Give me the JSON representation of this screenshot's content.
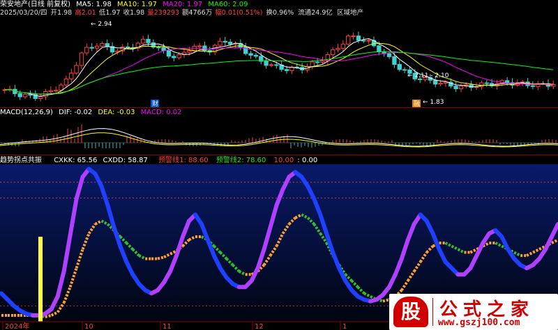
{
  "header": {
    "stock_title": "荣安地产(日线 前复权)",
    "ma5": "MA5: 1.98",
    "ma10": "MA10: 1.97",
    "ma20": "MA20: 1.97",
    "ma60": "MA60: 2.09",
    "date": "2025/03/20/四",
    "open": "开1.98",
    "high": "高2.01",
    "low": "低1.97",
    "close": "收1.98",
    "volume": "量239293",
    "amount": "额4766万",
    "change": "幅0.01(0.51%)",
    "turnover": "换0.96%",
    "float_cap": "流通24.9亿",
    "sector": "区域地产"
  },
  "macd_header": {
    "title": "MACD(12,26,9)",
    "dif": "DIF: -0.02",
    "dea": "DEA: -0.03",
    "macd": "MACD: 0.02"
  },
  "ind_header": {
    "title": "趋势拐点共振",
    "cxkk": "CXKK: 65.56",
    "cxdd": "CXDD: 58.87",
    "warn1": "预警线1: 88.60",
    "warn2": "预警线2: 78.60",
    "ten": "10.00",
    "zero": ": 0.00"
  },
  "annotations": {
    "high_price": "2.94",
    "low_price": "1.83",
    "range_label": "2.11 - 2.10",
    "badge_cai": "财",
    "badge_mao": "融"
  },
  "x_axis": {
    "labels": [
      "2024年",
      "10",
      "11",
      "12",
      "1"
    ]
  },
  "colors": {
    "up": "#ff4040",
    "down": "#40d0d0",
    "ma5": "#ffffff",
    "ma10": "#ffff00",
    "ma20": "#ff00ff",
    "ma60": "#00ff00",
    "cxkk_up": "#b040ff",
    "cxkk_down": "#2040ff",
    "cxdd_up": "#ffa030",
    "cxdd_down": "#30c030",
    "warn": "#ff4040",
    "marker": "#ffff40"
  },
  "logo": {
    "mark": "股",
    "name": "公式之家",
    "url": "www.gszj100.com"
  },
  "chart_data": [
    {
      "type": "candlestick",
      "title": "荣安地产(日线 前复权)",
      "ylim": [
        1.8,
        3.0
      ],
      "annotations": [
        {
          "label": "2.94"
        },
        {
          "label": "1.83"
        },
        {
          "label": "2.11 - 2.10"
        }
      ],
      "values": []
    },
    {
      "type": "bar",
      "title": "MACD(12,26,9)",
      "series": [
        {
          "name": "DIF",
          "last": -0.02
        },
        {
          "name": "DEA",
          "last": -0.03
        },
        {
          "name": "MACD",
          "last": 0.02
        }
      ]
    },
    {
      "type": "line",
      "title": "趋势拐点共振",
      "ylim": [
        0,
        100
      ],
      "reference_lines": [
        88.6,
        78.6,
        10.0,
        0.0
      ],
      "series": [
        {
          "name": "CXKK",
          "values": [
            18,
            14,
            10,
            7,
            5,
            4,
            4,
            5,
            8,
            16,
            32,
            55,
            78,
            92,
            97,
            94,
            86,
            74,
            60,
            48,
            38,
            30,
            24,
            20,
            18,
            20,
            25,
            32,
            42,
            54,
            64,
            68,
            62,
            52,
            42,
            34,
            28,
            24,
            22,
            22,
            26,
            34,
            46,
            60,
            74,
            84,
            92,
            95,
            92,
            86,
            78,
            68,
            56,
            44,
            34,
            26,
            20,
            16,
            14,
            13,
            14,
            17,
            22,
            30,
            40,
            52,
            62,
            68,
            64,
            56,
            46,
            38,
            34,
            30,
            30,
            34,
            42,
            50,
            56,
            58,
            54,
            46,
            40,
            36,
            34,
            36,
            40,
            46,
            54,
            62
          ]
        },
        {
          "name": "CXDD",
          "values": [
            4,
            4,
            4,
            4,
            4,
            4,
            4,
            3,
            4,
            6,
            12,
            22,
            34,
            46,
            56,
            62,
            64,
            62,
            58,
            54,
            50,
            46,
            42,
            40,
            40,
            40,
            41,
            43,
            45,
            48,
            52,
            54,
            54,
            52,
            48,
            44,
            40,
            36,
            32,
            30,
            30,
            32,
            36,
            42,
            48,
            56,
            62,
            66,
            68,
            66,
            62,
            56,
            50,
            42,
            36,
            30,
            26,
            22,
            18,
            16,
            14,
            13,
            14,
            16,
            20,
            26,
            32,
            38,
            44,
            48,
            50,
            50,
            48,
            46,
            44,
            44,
            46,
            48,
            50,
            50,
            48,
            46,
            44,
            42,
            42,
            44,
            46,
            48,
            50,
            52
          ]
        }
      ]
    }
  ]
}
